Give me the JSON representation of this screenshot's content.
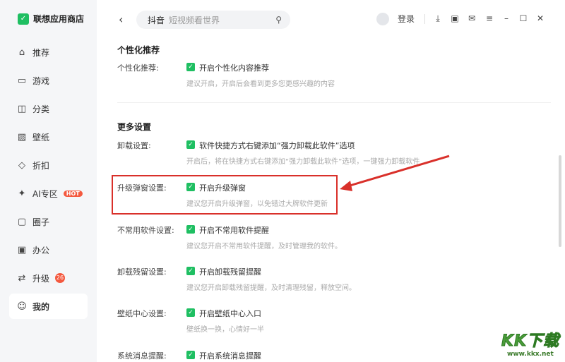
{
  "app": {
    "name": "联想应用商店"
  },
  "sidebar": {
    "items": [
      {
        "label": "推荐",
        "icon": "home-icon"
      },
      {
        "label": "游戏",
        "icon": "gamepad-icon"
      },
      {
        "label": "分类",
        "icon": "category-icon"
      },
      {
        "label": "壁纸",
        "icon": "image-icon"
      },
      {
        "label": "折扣",
        "icon": "tag-icon"
      },
      {
        "label": "AI专区",
        "icon": "ai-icon",
        "badge": "HOT"
      },
      {
        "label": "圈子",
        "icon": "chat-icon"
      },
      {
        "label": "办公",
        "icon": "briefcase-icon"
      },
      {
        "label": "升级",
        "icon": "swap-icon",
        "count": "26"
      },
      {
        "label": "我的",
        "icon": "user-icon",
        "active": true
      }
    ]
  },
  "header": {
    "search_keyword": "抖音",
    "search_hint": "短视频看世界",
    "login": "登录"
  },
  "settings": {
    "sec1": "个性化推荐",
    "sec2": "更多设置",
    "rows": [
      {
        "label": "个性化推荐:",
        "option": "开启个性化内容推荐",
        "desc": "建议开启，开启后会看到更多您更感兴趣的内容"
      },
      {
        "label": "卸载设置:",
        "option": "软件快捷方式右键添加“强力卸载此软件”选项",
        "desc": "开启后，将在快捷方式右键添加“强力卸载此软件”选项，一键强力卸载软件"
      },
      {
        "label": "升级弹窗设置:",
        "option": "开启升级弹窗",
        "desc": "建议您开启升级弹窗，以免错过大牌软件更新"
      },
      {
        "label": "不常用软件设置:",
        "option": "开启不常用软件提醒",
        "desc": "建议您开启不常用软件提醒，及时管理我的软件。"
      },
      {
        "label": "卸载残留设置:",
        "option": "开启卸载残留提醒",
        "desc": "建议您开启卸载残留提醒，及时清理残留，释放空间。"
      },
      {
        "label": "壁纸中心设置:",
        "option": "开启壁纸中心入口",
        "desc": "壁纸换一换，心情好一半"
      },
      {
        "label": "系统消息提醒:",
        "option": "开启系统消息提醒",
        "desc": ""
      }
    ]
  },
  "watermark": {
    "logo": "KK下载",
    "url": "www.kkx.net"
  },
  "colors": {
    "accent": "#1fbf62",
    "highlight": "#d9302a"
  }
}
